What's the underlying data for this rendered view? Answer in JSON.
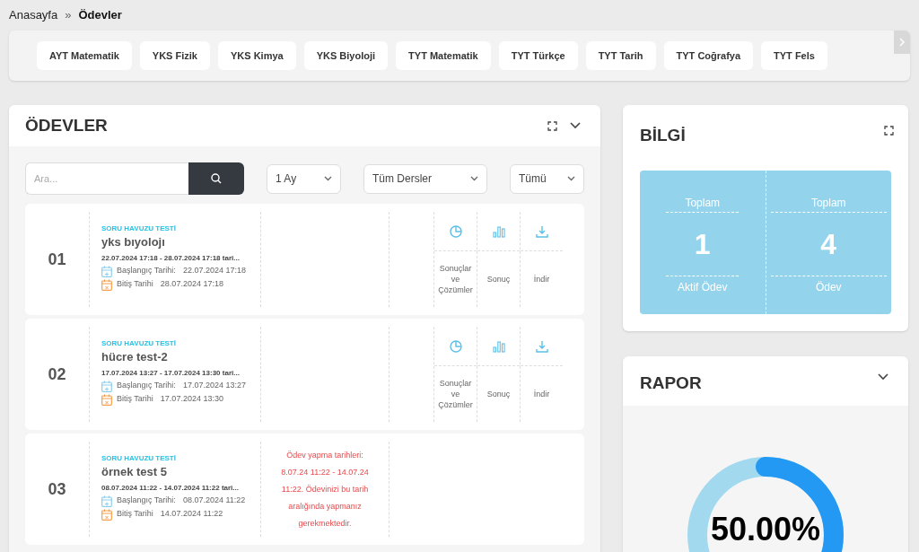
{
  "breadcrumb": [
    {
      "label": "Anasayfa",
      "current": false
    },
    {
      "label": "Ödevler",
      "current": true
    }
  ],
  "breadcrumb_separator": "»",
  "subjects": [
    "AYT Matematik",
    "YKS Fizik",
    "YKS Kimya",
    "YKS Biyoloji",
    "TYT Matematik",
    "TYT Türkçe",
    "TYT Tarih",
    "TYT Coğrafya",
    "TYT Fels"
  ],
  "homework": {
    "title": "ÖDEVLER",
    "search": {
      "placeholder": "Ara..."
    },
    "filters": [
      "1 Ay",
      "Tüm Dersler",
      "Tümü"
    ],
    "rows": [
      {
        "number": "01",
        "type": "SORU HAVUZU TESTİ",
        "title": "yks bıyolojı",
        "range": "22.07.2024 17:18 - 28.07.2024 17:18 tari...",
        "start_label": "Başlangıç Tarihi:",
        "start": "22.07.2024 17:18",
        "end_label": "Bitiş Tarihi",
        "end": "28.07.2024 17:18",
        "actions": [
          {
            "kind": "pie",
            "label": "Sonuçlar ve Çözümler"
          },
          {
            "kind": "bars",
            "label": "Sonuç"
          },
          {
            "kind": "download",
            "label": "İndir"
          }
        ]
      },
      {
        "number": "02",
        "type": "SORU HAVUZU TESTİ",
        "title": "hücre test-2",
        "range": "17.07.2024 13:27 - 17.07.2024 13:30 tari...",
        "start_label": "Başlangıç Tarihi:",
        "start": "17.07.2024 13:27",
        "end_label": "Bitiş Tarihi",
        "end": "17.07.2024 13:30",
        "actions": [
          {
            "kind": "pie",
            "label": "Sonuçlar ve Çözümler"
          },
          {
            "kind": "bars",
            "label": "Sonuç"
          },
          {
            "kind": "download",
            "label": "İndir"
          }
        ]
      },
      {
        "number": "03",
        "type": "SORU HAVUZU TESTİ",
        "title": "örnek test 5",
        "range": "08.07.2024 11:22 - 14.07.2024 11:22 tari...",
        "start_label": "Başlangıç Tarihi:",
        "start": "08.07.2024 11:22",
        "end_label": "Bitiş Tarihi",
        "end": "14.07.2024 11:22",
        "message": "Ödev yapma tarihleri: 8.07.24 11:22 - 14.07.24 11:22. Ödevinizi bu tarih aralığında yapmanız gerekmektedir."
      }
    ]
  },
  "info": {
    "title": "BİLGİ",
    "stats": [
      {
        "top": "Toplam",
        "value": "1",
        "bottom": "Aktif Ödev"
      },
      {
        "top": "Toplam",
        "value": "4",
        "bottom": "Ödev"
      }
    ]
  },
  "report": {
    "title": "RAPOR",
    "level": 0.5,
    "reading": "50.00%"
  }
}
